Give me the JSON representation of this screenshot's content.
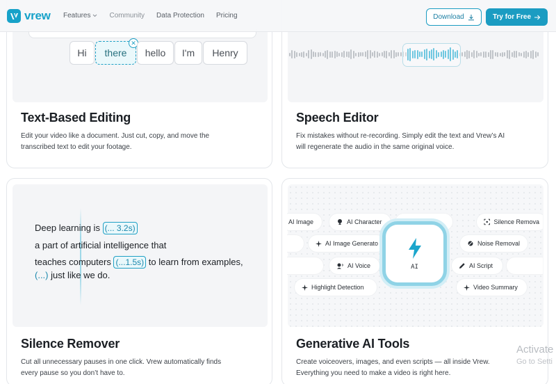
{
  "header": {
    "logo_text": "vrew",
    "nav": [
      {
        "label": "Features"
      },
      {
        "label": "Community"
      },
      {
        "label": "Data Protection"
      },
      {
        "label": "Pricing"
      }
    ],
    "download_label": "Download",
    "try_label": "Try for Free"
  },
  "cards": {
    "text_editing": {
      "title": "Text-Based Editing",
      "desc_line1": "Edit your video like a document. Just cut, copy, and move the",
      "desc_line2": "transcribed text to edit your footage.",
      "words": [
        "Hi",
        "there",
        "hello",
        "I'm",
        "Henry"
      ],
      "selected_word": "there"
    },
    "speech_editor": {
      "title": "Speech Editor",
      "desc_line1": "Fix mistakes without re-recording. Simply edit the text and Vrew’s AI",
      "desc_line2": "will regenerate the audio in the same original voice."
    },
    "silence_remover": {
      "title": "Silence Remover",
      "desc_line1": "Cut all unnecessary pauses in one click. Vrew automatically finds",
      "desc_line2": "every pause so you don’t have to.",
      "line1_text": "Deep learning is ",
      "line1_pause": "(... 3.2s)",
      "line2_text": "a part of artificial intelligence that",
      "line3_text": "teaches computers ",
      "line3_pause": "(...1.5s)",
      "line3_after": " to learn from examples,",
      "line4_pause": "(...)",
      "line4_text": " just like we do."
    },
    "generative_ai": {
      "title": "Generative AI Tools",
      "desc_line1": "Create voiceovers, images, and even scripts — all inside Vrew.",
      "desc_line2": "Everything you need to make a video is right here.",
      "center_label": "AI",
      "pills": {
        "ai_image": "AI Image",
        "ai_character": "AI Character",
        "silence_removal": "Silence Remova",
        "ai_image_generator": "AI Image Generato",
        "noise_removal": "Noise Removal",
        "ai_voice": "AI Voice",
        "ai_script": "AI Script",
        "highlight_detection": "Highlight Detection",
        "video_summary": "Video Summary"
      }
    }
  },
  "watermark": {
    "title": "Activate",
    "sub": "Go to Setti"
  },
  "colors": {
    "brand": "#17a2c9",
    "accent": "#1b9cc2",
    "card_border": "#e3e6ea"
  }
}
